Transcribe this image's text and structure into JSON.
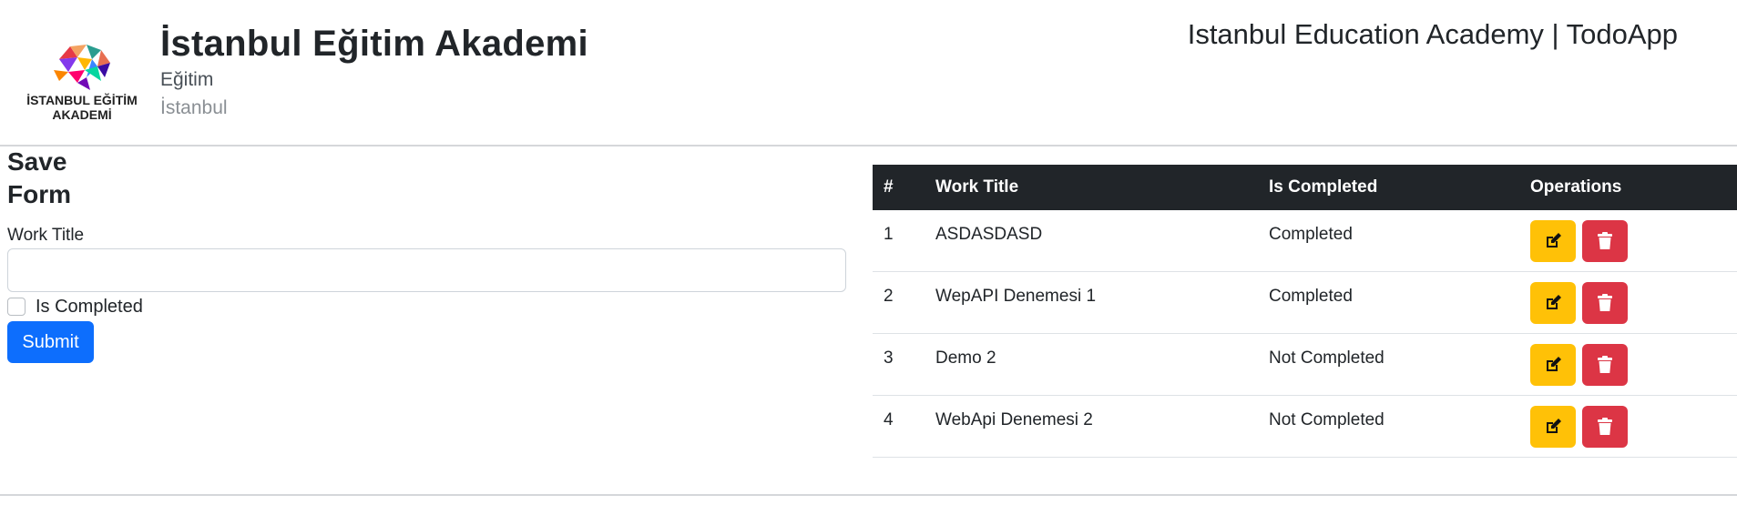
{
  "header": {
    "logo_text_line1": "İSTANBUL EĞİTİM",
    "logo_text_line2": "AKADEMİ",
    "brand_title": "İstanbul Eğitim Akademi",
    "brand_sub1": "Eğitim",
    "brand_sub2": "İstanbul",
    "site_title": "Istanbul Education Academy | TodoApp"
  },
  "form": {
    "heading": "Save Form",
    "work_title_label": "Work Title",
    "work_title_value": "",
    "is_completed_label": "Is Completed",
    "is_completed_checked": false,
    "submit_label": "Submit"
  },
  "table": {
    "columns": [
      "#",
      "Work Title",
      "Is Completed",
      "Operations"
    ],
    "rows": [
      {
        "id": "1",
        "title": "ASDASDASD",
        "status": "Completed"
      },
      {
        "id": "2",
        "title": "WepAPI Denemesi 1",
        "status": "Completed"
      },
      {
        "id": "3",
        "title": "Demo 2",
        "status": "Not Completed"
      },
      {
        "id": "4",
        "title": "WebApi Denemesi 2",
        "status": "Not Completed"
      }
    ],
    "edit_icon": "edit-icon",
    "delete_icon": "trash-icon"
  },
  "colors": {
    "primary": "#0d6efd",
    "warning": "#ffc107",
    "danger": "#dc3545",
    "table_header": "#212529"
  }
}
